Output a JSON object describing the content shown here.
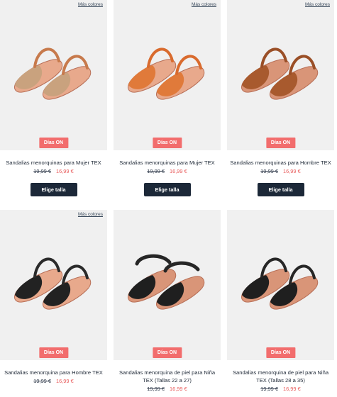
{
  "products": [
    {
      "more_colors": "Más colores",
      "badge": "Días ON",
      "name": "Sandalias menorquinas para Mujer TEX",
      "old_price": "19,99 €",
      "new_price": "16,99 €",
      "button": "Elige talla",
      "upper_color": "#c9a27e",
      "strap_color": "#c77a4c",
      "sole_color": "#e8a98c",
      "image_icon": "sandal-beige-icon"
    },
    {
      "more_colors": "Más colores",
      "badge": "Días ON",
      "name": "Sandalias menorquinas para Mujer TEX",
      "old_price": "19,99 €",
      "new_price": "16,99 €",
      "button": "Elige talla",
      "upper_color": "#e07a3a",
      "strap_color": "#d96b2e",
      "sole_color": "#e8a98c",
      "image_icon": "sandal-orange-icon"
    },
    {
      "more_colors": "Más colores",
      "badge": "Días ON",
      "name": "Sandalias menorquinas para Hombre TEX",
      "old_price": "19,99 €",
      "new_price": "16,99 €",
      "button": "Elige talla",
      "upper_color": "#a85a2e",
      "strap_color": "#9a4f27",
      "sole_color": "#d99578",
      "image_icon": "sandal-brown-icon"
    },
    {
      "more_colors": "Más colores",
      "badge": "Días ON",
      "name": "Sandalias menorquina para Hombre TEX",
      "old_price": "19,99 €",
      "new_price": "16,99 €",
      "upper_color": "#222222",
      "strap_color": "#2a2a2a",
      "sole_color": "#e8a98c",
      "image_icon": "sandal-black-icon"
    },
    {
      "badge": "Días ON",
      "name": "Sandalias menorquina de piel para Niña TEX (Tallas 22 a 27)",
      "old_price": "19,99 €",
      "new_price": "16,99 €",
      "upper_color": "#1f1f1f",
      "strap_color": "#262626",
      "sole_color": "#d99578",
      "image_icon": "kids-sandal-black-icon"
    },
    {
      "badge": "Días ON",
      "name": "Sandalias menorquina de piel para Niña TEX (Tallas 28 a 35)",
      "old_price": "19,99 €",
      "new_price": "16,99 €",
      "upper_color": "#1f1f1f",
      "strap_color": "#262626",
      "sole_color": "#d99578",
      "image_icon": "sandal-black-icon"
    }
  ]
}
